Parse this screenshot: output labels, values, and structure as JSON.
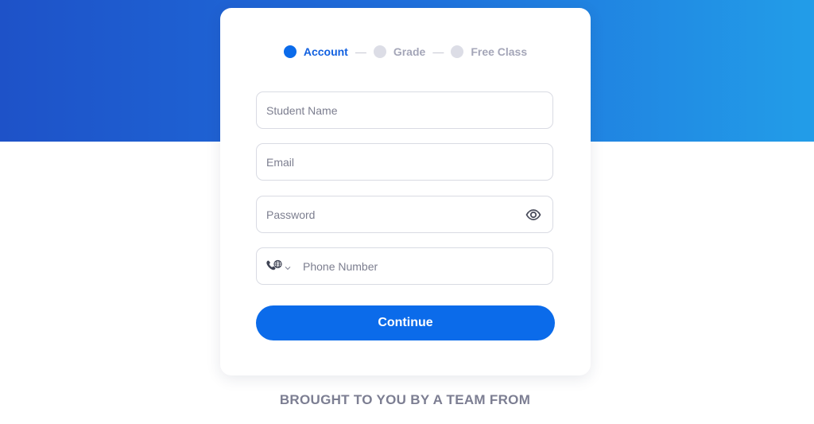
{
  "steps": [
    {
      "label": "Account",
      "active": true
    },
    {
      "label": "Grade",
      "active": false
    },
    {
      "label": "Free Class",
      "active": false
    }
  ],
  "step_separator": "—",
  "form": {
    "student_name": {
      "placeholder": "Student Name",
      "value": ""
    },
    "email": {
      "placeholder": "Email",
      "value": ""
    },
    "password": {
      "placeholder": "Password",
      "value": "",
      "toggle_icon": "eye-icon"
    },
    "phone": {
      "placeholder": "Phone Number",
      "value": "",
      "country_icon": "globe-phone-icon",
      "dropdown_icon": "chevron-down-icon"
    }
  },
  "continue_label": "Continue",
  "footer_text": "BROUGHT TO YOU BY A TEAM FROM",
  "colors": {
    "primary": "#0b6bea",
    "hero_start": "#1e52c8",
    "hero_end": "#229de8",
    "muted_text": "#7c7e92"
  }
}
